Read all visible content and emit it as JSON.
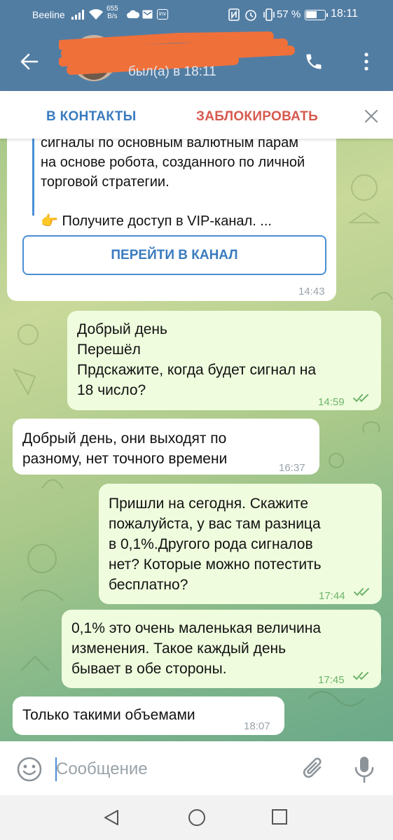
{
  "status_bar": {
    "carrier": "Beeline",
    "net_speed_value": "655",
    "net_speed_unit": "B/s",
    "battery_percent": "57 %",
    "battery_level": 0.57,
    "time": "18:11"
  },
  "header": {
    "contact_name": "••••••••••• ...",
    "last_seen": "был(а) в 18:11"
  },
  "action_bar": {
    "add_contact_label": "В КОНТАКТЫ",
    "block_label": "ЗАБЛОКИРОВАТЬ"
  },
  "messages": [
    {
      "direction": "in",
      "lines": [
        "сигналы по основным валютным парам",
        "на основе робота, созданного по личной",
        "торговой стратегии.",
        "",
        "👉 Получите доступ в VIP-канал. ..."
      ],
      "button_label": "ПЕРЕЙТИ В КАНАЛ",
      "time": "14:43"
    },
    {
      "direction": "out",
      "text": "Добрый день\nПерешёл\nПрдскажите, когда будет сигнал на\n18 число?",
      "time": "14:59"
    },
    {
      "direction": "in",
      "text": "Добрый день, они выходят по\nразному, нет точного времени",
      "time": "16:37"
    },
    {
      "direction": "out",
      "text": "Пришли на сегодня. Скажите\nпожалуйста, у вас там разница\nв 0,1%.Другого рода сигналов\nнет? Которые можно потестить\nбесплатно?",
      "time": "17:44"
    },
    {
      "direction": "out",
      "text": "0,1% это очень маленькая величина\nизменения. Такое каждый день\nбывает в обе стороны.",
      "time": "17:45"
    },
    {
      "direction": "in",
      "text": "Только такими объемами",
      "time": "18:07"
    }
  ],
  "input": {
    "placeholder": "Сообщение",
    "value": ""
  },
  "colors": {
    "header_bg": "#527da3",
    "accent_blue": "#3a7bbf",
    "block_red": "#d65a4f",
    "outgoing_bubble": "#effdde",
    "incoming_bubble": "#ffffff",
    "read_ticks": "#6eb36b"
  },
  "icons": {
    "back": "arrow-left-icon",
    "call": "phone-icon",
    "menu": "more-vertical-icon",
    "close": "close-icon",
    "emoji": "smile-icon",
    "attach": "paperclip-icon",
    "mic": "microphone-icon",
    "read": "double-check-icon"
  }
}
